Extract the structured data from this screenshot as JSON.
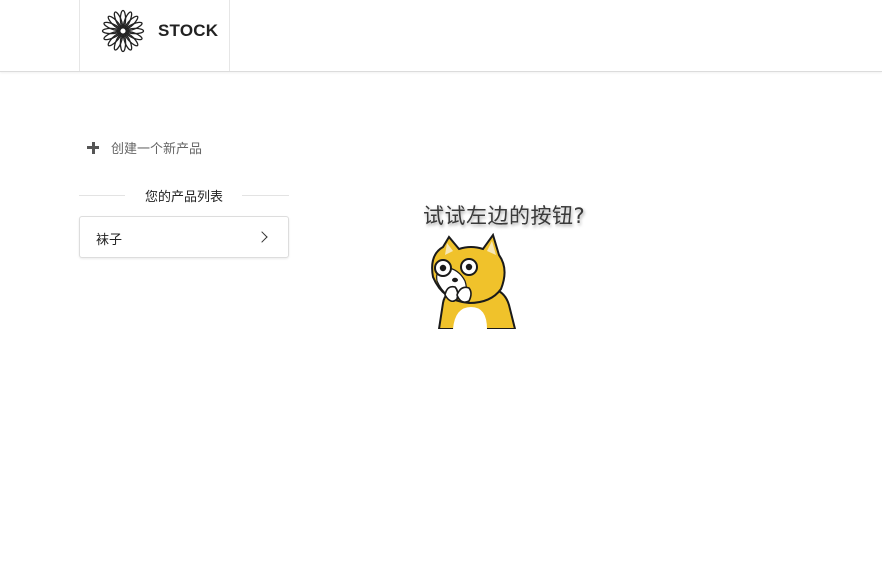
{
  "header": {
    "brand_name": "STOCK",
    "logo_icon": "flower-icon"
  },
  "sidebar": {
    "create_label": "创建一个新产品",
    "create_icon": "plus-icon",
    "section_title": "您的产品列表",
    "products": [
      {
        "label": "袜子",
        "icon": "chevron-right-icon"
      }
    ]
  },
  "main": {
    "hint_text": "试试左边的按钮?",
    "illustration": "doge-cartoon"
  },
  "colors": {
    "accent_yellow": "#f0c22b",
    "text_dark": "#222222",
    "text_muted": "#666666",
    "border": "#dddddd"
  }
}
